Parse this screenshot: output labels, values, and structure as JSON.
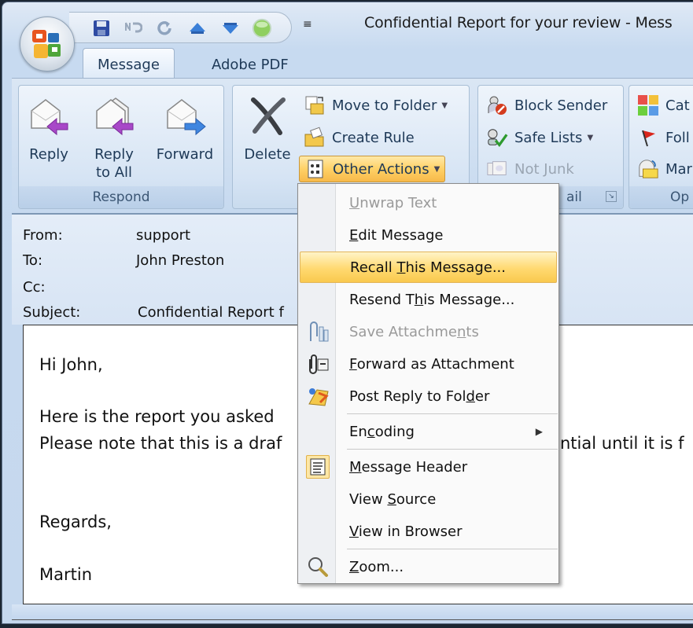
{
  "window": {
    "title": "Confidential Report for your review  -  Mess"
  },
  "quick_access": {
    "items": [
      "save-icon",
      "undo-icon",
      "redo-icon",
      "previous-item-icon",
      "next-item-icon",
      "status-orb-icon"
    ],
    "more": "≡"
  },
  "tabs": [
    {
      "label": "Message",
      "active": true
    },
    {
      "label": "Adobe PDF",
      "active": false
    }
  ],
  "ribbon": {
    "respond": {
      "label": "Respond",
      "reply": "Reply",
      "reply_all_line1": "Reply",
      "reply_all_line2": "to All",
      "forward": "Forward"
    },
    "actions": {
      "delete": "Delete",
      "move_to_folder": "Move to Folder",
      "create_rule": "Create Rule",
      "other_actions": "Other Actions"
    },
    "junk": {
      "block_sender": "Block Sender",
      "safe_lists": "Safe Lists",
      "not_junk": "Not Junk",
      "label_fragment": "ail"
    },
    "options": {
      "categorize": "Cat",
      "follow_up": "Foll",
      "mark": "Mar",
      "label_fragment": "Op"
    }
  },
  "header": {
    "from_label": "From:",
    "from_value": "support",
    "to_label": "To:",
    "to_value": "John Preston",
    "cc_label": "Cc:",
    "cc_value": "",
    "subject_label": "Subject:",
    "subject_value": "Confidential Report f"
  },
  "body": {
    "greeting": "Hi John,",
    "line1": "Here is the report you asked",
    "line2_left": "Please note that this is a draf",
    "line2_right": "ntial until it is f",
    "closing": "Regards,",
    "signature": "Martin"
  },
  "menu": {
    "items": [
      {
        "pre": "",
        "u": "U",
        "post": "nwrap Text",
        "disabled": true
      },
      {
        "pre": "",
        "u": "E",
        "post": "dit Message",
        "disabled": false
      },
      {
        "pre": "Recall ",
        "u": "T",
        "post": "his Message...",
        "disabled": false,
        "highlighted": true
      },
      {
        "pre": "Resend T",
        "u": "h",
        "post": "is Message...",
        "disabled": false
      },
      {
        "pre": "Save Attachme",
        "u": "n",
        "post": "ts",
        "disabled": true
      },
      {
        "pre": "",
        "u": "F",
        "post": "orward as Attachment",
        "disabled": false
      },
      {
        "pre": "Post Reply to Fol",
        "u": "d",
        "post": "er",
        "disabled": false
      },
      {
        "pre": "En",
        "u": "c",
        "post": "oding",
        "disabled": false,
        "submenu": true
      },
      {
        "pre": "",
        "u": "M",
        "post": "essage Header",
        "disabled": false,
        "checked": true
      },
      {
        "pre": "View ",
        "u": "S",
        "post": "ource",
        "disabled": false
      },
      {
        "pre": "",
        "u": "V",
        "post": "iew in Browser",
        "disabled": false
      },
      {
        "pre": "",
        "u": "Z",
        "post": "oom...",
        "disabled": false
      }
    ],
    "submenu_arrow": "▶"
  },
  "colors": {
    "highlight": "#ffd970",
    "ribbon_blue": "#c6d9ef",
    "text_blue": "#1e3957"
  }
}
